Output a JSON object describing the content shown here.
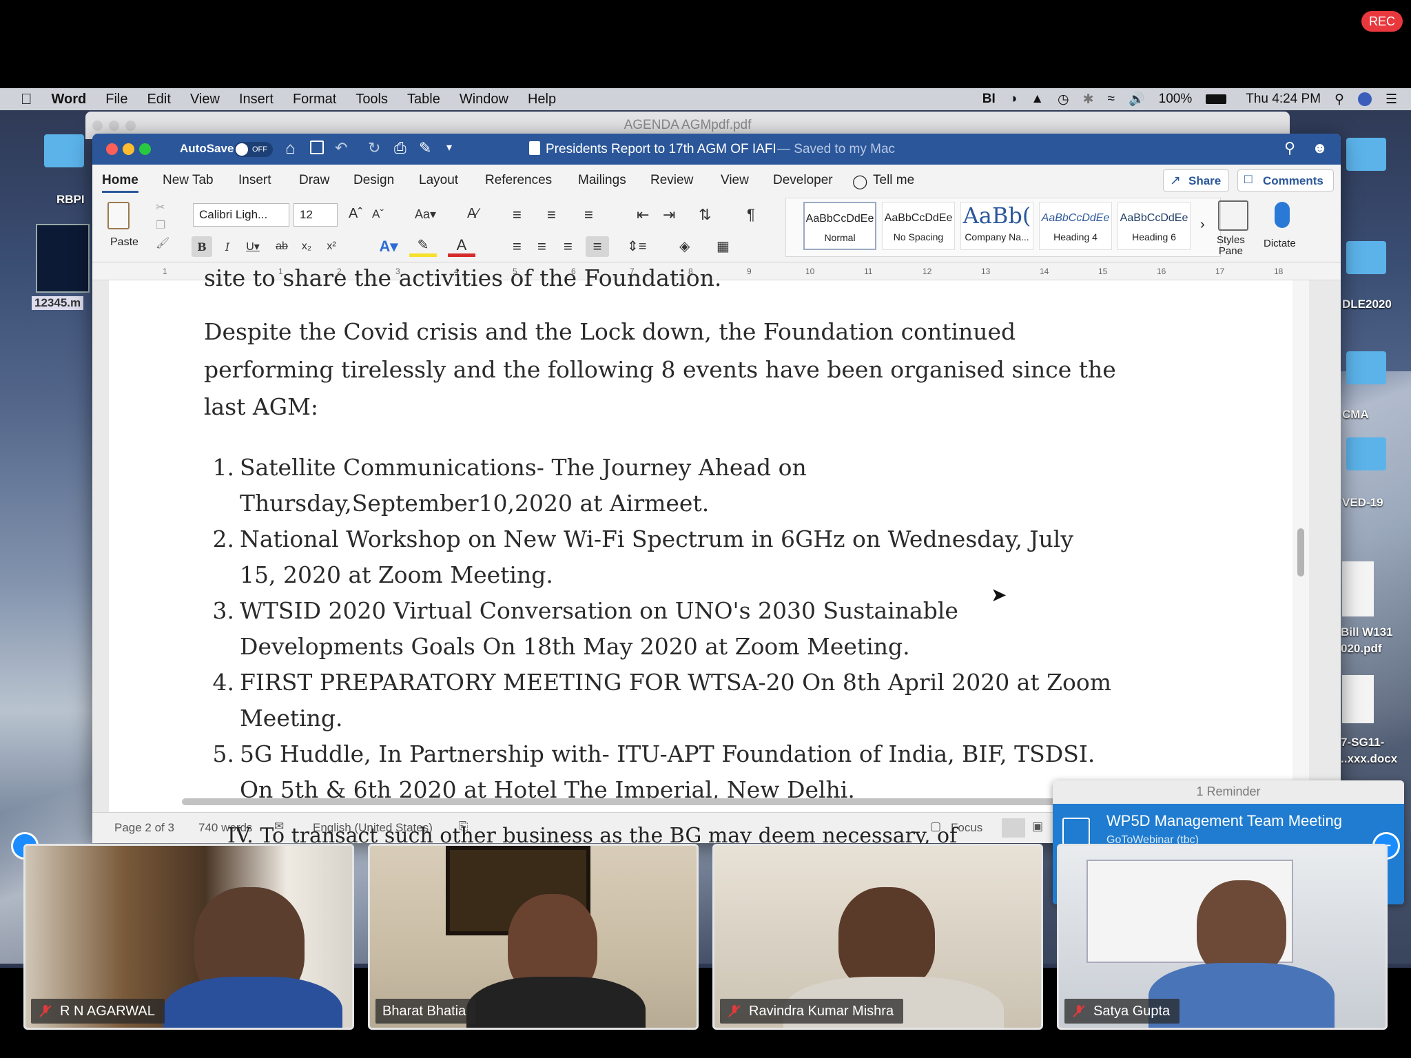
{
  "recording": {
    "label": "REC"
  },
  "menubar": {
    "app_name": "Word",
    "items": [
      "File",
      "Edit",
      "View",
      "Insert",
      "Format",
      "Tools",
      "Table",
      "Window",
      "Help"
    ],
    "battery": "100%",
    "clock": "Thu 4:24 PM"
  },
  "background_window": {
    "title": "AGENDA AGMpdf.pdf"
  },
  "desktop_labels": {
    "left_top": "RBPI",
    "left_file": "12345.m",
    "r1": "DLE2020",
    "r2": "CMA",
    "r3": "VED-19",
    "r4a": "Bill W131",
    "r4b": "020.pdf",
    "r5a": "7-SG11-",
    "r5b": "..xxx.docx"
  },
  "word": {
    "autosave_label": "AutoSave",
    "autosave_state": "OFF",
    "doc_title": "Presidents Report to 17th AGM OF IAFI",
    "save_status": "— Saved to my Mac",
    "tabs": [
      "Home",
      "New Tab",
      "Insert",
      "Draw",
      "Design",
      "Layout",
      "References",
      "Mailings",
      "Review",
      "View",
      "Developer"
    ],
    "tell_me": "Tell me",
    "share": "Share",
    "comments": "Comments",
    "paste": "Paste",
    "font_name": "Calibri Ligh...",
    "font_size": "12",
    "styles": [
      {
        "preview": "AaBbCcDdEe",
        "name": "Normal"
      },
      {
        "preview": "AaBbCcDdEe",
        "name": "No Spacing"
      },
      {
        "preview": "AaBb(",
        "name": "Company Na..."
      },
      {
        "preview": "AaBbCcDdEe",
        "name": "Heading 4"
      },
      {
        "preview": "AaBbCcDdEe",
        "name": "Heading 6"
      }
    ],
    "styles_pane": "Styles\nPane",
    "dictate": "Dictate",
    "ruler_ticks": [
      "1",
      "1",
      "2",
      "3",
      "4",
      "5",
      "6",
      "7",
      "8",
      "9",
      "10",
      "11",
      "12",
      "13",
      "14",
      "15",
      "16",
      "17",
      "18"
    ],
    "document": {
      "cut_line": "site to share the activities of the Foundation.",
      "paragraph": [
        "Despite the Covid crisis and the Lock down, the Foundation continued",
        "performing tirelessly and the following 8 events have been organised  since the",
        "last AGM:"
      ],
      "list": [
        {
          "num": "1.",
          "lines": [
            "Satellite Communications- The Journey Ahead on",
            "Thursday,September10,2020 at Airmeet."
          ]
        },
        {
          "num": "2.",
          "lines": [
            "National Workshop on New Wi-Fi Spectrum in 6GHz on Wednesday, July",
            "15, 2020 at Zoom Meeting."
          ]
        },
        {
          "num": "3.",
          "lines": [
            "WTSID 2020 Virtual Conversation on UNO's 2030 Sustainable",
            "Developments Goals On 18th May 2020 at Zoom Meeting."
          ]
        },
        {
          "num": "4.",
          "lines": [
            "FIRST PREPARATORY MEETING FOR WTSA-20 On 8th April 2020 at Zoom",
            "Meeting."
          ]
        },
        {
          "num": "5.",
          "lines": [
            "5G Huddle, In Partnership with- ITU-APT Foundation of India, BIF, TSDSI.",
            "On 5th & 6th 2020 at Hotel The Imperial, New Delhi."
          ]
        }
      ]
    },
    "status": {
      "page": "Page 2 of 3",
      "words": "740 words",
      "language": "English (United States)",
      "focus": "Focus"
    }
  },
  "behind_text": "IV. To transact such other business as the BG may deem necessary, of",
  "reminder": {
    "header": "1 Reminder",
    "title": "WP5D Management Team Meeting",
    "subtitle": "GoToWebinar (tbc)"
  },
  "participants": [
    {
      "name": "R N AGARWAL"
    },
    {
      "name": "Bharat Bhatia"
    },
    {
      "name": "Ravindra Kumar Mishra"
    },
    {
      "name": "Satya Gupta"
    }
  ]
}
